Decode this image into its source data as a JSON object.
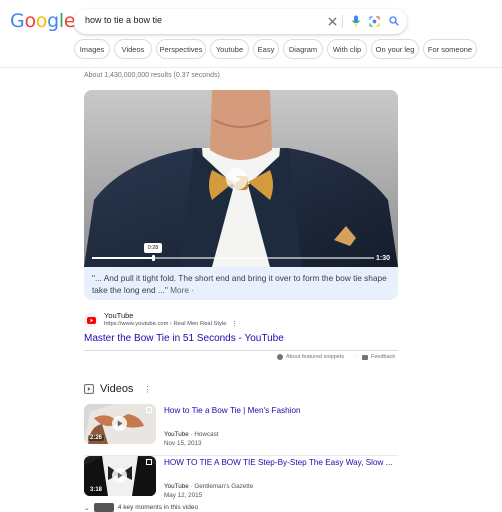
{
  "header": {
    "logo": [
      "G",
      "o",
      "o",
      "g",
      "l",
      "e"
    ],
    "logo_colors": [
      "#4285F4",
      "#EA4335",
      "#FBBC05",
      "#4285F4",
      "#34A853",
      "#EA4335"
    ],
    "query": "how to tie a bow tie",
    "icons": [
      "clear-icon",
      "mic-icon",
      "lens-icon",
      "search-icon"
    ],
    "chips": [
      "Images",
      "Videos",
      "Perspectives",
      "Youtube",
      "Easy",
      "Diagram",
      "With clip",
      "On your leg",
      "For someone"
    ]
  },
  "stats": "About 1,430,000,000 results (0.37 seconds)",
  "featured": {
    "scrub_time": "0:28",
    "duration": "1:30",
    "progress_fraction": 0.22,
    "caption": "\"... And pull it tight fold. The short end and bring it over to form the bow tie shape take the long end ...\"",
    "more": "More ·",
    "source_name": "YouTube",
    "source_url": "https://www.youtube.com › Real Men Real Style",
    "title": "Master the Bow Tie in 51 Seconds - YouTube",
    "about": "About featured snippets",
    "feedback": "Feedback"
  },
  "videos": {
    "heading": "Videos",
    "items": [
      {
        "title": "How to Tie a Bow Tie | Men's Fashion",
        "source": "YouTube",
        "channel": "· Howcast",
        "date": "Nov 15, 2013",
        "duration": "2:26"
      },
      {
        "title": "HOW TO TIE A BOW TIE Step-By-Step The Easy Way, Slow ...",
        "source": "YouTube",
        "channel": "· Gentleman's Gazette",
        "date": "May 12, 2015",
        "duration": "3:18"
      }
    ],
    "key_moments": "4 key moments in this video"
  },
  "colors": {
    "link": "#1a0dab",
    "accent_blue": "#4285F4",
    "youtube_red": "#FF0000",
    "card_bg": "#e8f0fe"
  }
}
